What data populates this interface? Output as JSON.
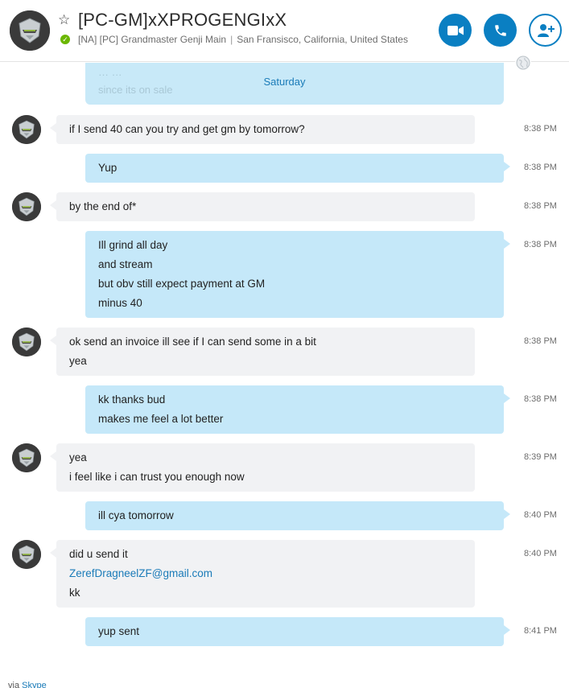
{
  "header": {
    "title": "[PC-GM]xXPROGENGIxX",
    "mood_left": "[NA] [PC] Grandmaster Genji Main",
    "mood_separator": "|",
    "mood_right": "San Fransisco, California, United States",
    "status_color": "#6bb700",
    "icons": {
      "favorite": "star-outline-icon",
      "video": "video-camera-icon",
      "call": "phone-icon",
      "add": "add-person-icon",
      "globe": "globe-icon"
    },
    "accent": "#0a7fc2"
  },
  "chat": {
    "faded_top_line": "… …",
    "faded_line": "since its on sale",
    "day_label": "Saturday",
    "messages": [
      {
        "dir": "in",
        "lines": [
          "if I send 40 can you try and get gm by tomorrow?"
        ],
        "time": "8:38 PM"
      },
      {
        "dir": "out",
        "lines": [
          "Yup"
        ],
        "time": "8:38 PM"
      },
      {
        "dir": "in",
        "lines": [
          "by the end of*"
        ],
        "time": "8:38 PM"
      },
      {
        "dir": "out",
        "lines": [
          "Ill grind all day",
          "and stream",
          "but obv still expect payment at GM",
          "minus 40"
        ],
        "time": "8:38 PM"
      },
      {
        "dir": "in",
        "lines": [
          "ok send an invoice ill see if I can send some in a bit",
          "yea"
        ],
        "time": "8:38 PM"
      },
      {
        "dir": "out",
        "lines": [
          "kk thanks bud",
          "makes me feel a lot better"
        ],
        "time": "8:38 PM"
      },
      {
        "dir": "in",
        "lines": [
          "yea",
          "i feel like i can trust you enough now"
        ],
        "time": "8:39 PM"
      },
      {
        "dir": "out",
        "lines": [
          "ill cya tomorrow"
        ],
        "time": "8:40 PM"
      },
      {
        "dir": "in",
        "lines": [
          "did u send it",
          "ZerefDragneelZF@gmail.com",
          "kk"
        ],
        "link_index": 1,
        "time": "8:40 PM"
      },
      {
        "dir": "out",
        "lines": [
          "yup sent"
        ],
        "time": "8:41 PM"
      }
    ]
  },
  "footer": {
    "prefix": "via",
    "brand": "Skype"
  }
}
